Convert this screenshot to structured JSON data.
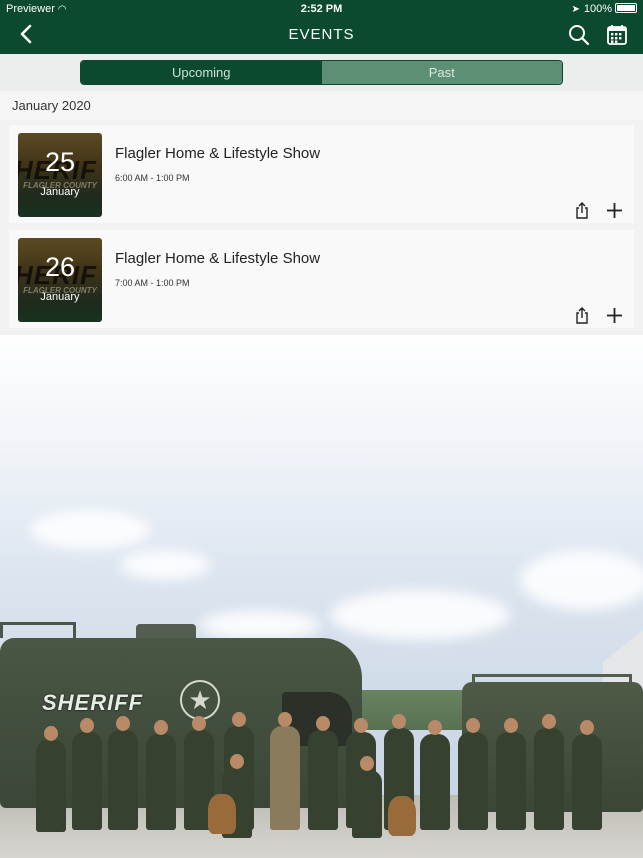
{
  "status_bar": {
    "carrier": "Previewer",
    "time": "2:52 PM",
    "battery": "100%"
  },
  "nav": {
    "title": "EVENTS"
  },
  "segments": {
    "upcoming": "Upcoming",
    "past": "Past",
    "selected": "Upcoming"
  },
  "section": {
    "header": "January 2020"
  },
  "events": [
    {
      "day": "25",
      "month": "January",
      "title": "Flagler Home & Lifestyle Show",
      "time": "6:00 AM - 1:00 PM"
    },
    {
      "day": "26",
      "month": "January",
      "title": "Flagler Home & Lifestyle Show",
      "time": "7:00 AM - 1:00 PM"
    }
  ],
  "background": {
    "vehicle_text": "SHERIFF"
  },
  "colors": {
    "brand": "#0c4a2f",
    "segment_inactive": "#5c8f74"
  },
  "icons": [
    "back-icon",
    "search-icon",
    "calendar-icon",
    "share-icon",
    "add-icon",
    "wifi-icon",
    "location-icon",
    "battery-icon"
  ]
}
